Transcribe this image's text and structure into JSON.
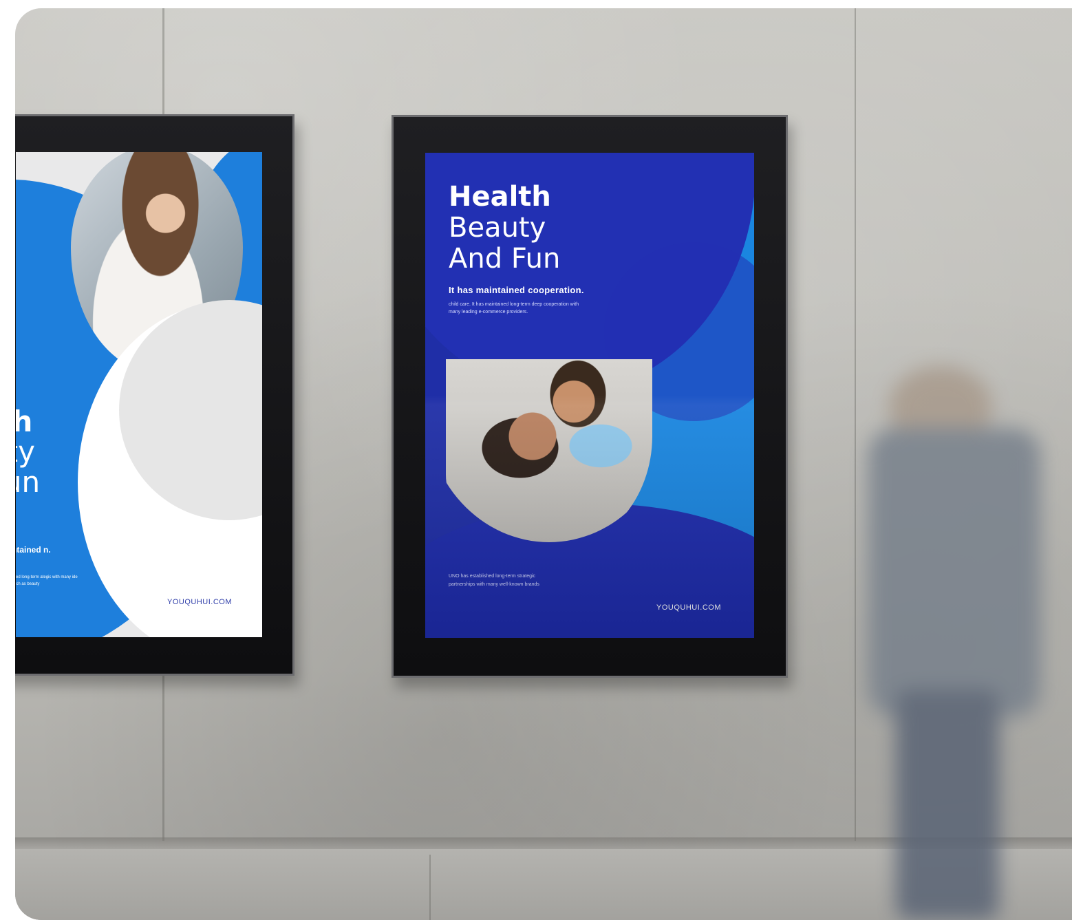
{
  "scene": "billboard mockup",
  "left_poster": {
    "title_bold": "lth",
    "title_line2": "uty",
    "title_line3": "Fun",
    "subtitle": "ntained n.",
    "body": "cked long-term ategic with many ide such as beauty",
    "brand": "YOUQUHUI.COM"
  },
  "right_poster": {
    "title_bold": "Health",
    "title_line2": "Beauty",
    "title_line3": "And Fun",
    "subtitle": "It has maintained cooperation.",
    "body": "child care. It has maintained long-term deep cooperation with many leading e-commerce providers.",
    "footer": "UNO has established long-term strategic partnerships with many well-known brands",
    "brand": "YOUQUHUI.COM"
  },
  "colors": {
    "poster_dark_blue": "#1f2ea7",
    "poster_light_blue": "#1a86e0",
    "left_poster_blue": "#1e7fdc",
    "wall": "#c3c2bd"
  }
}
